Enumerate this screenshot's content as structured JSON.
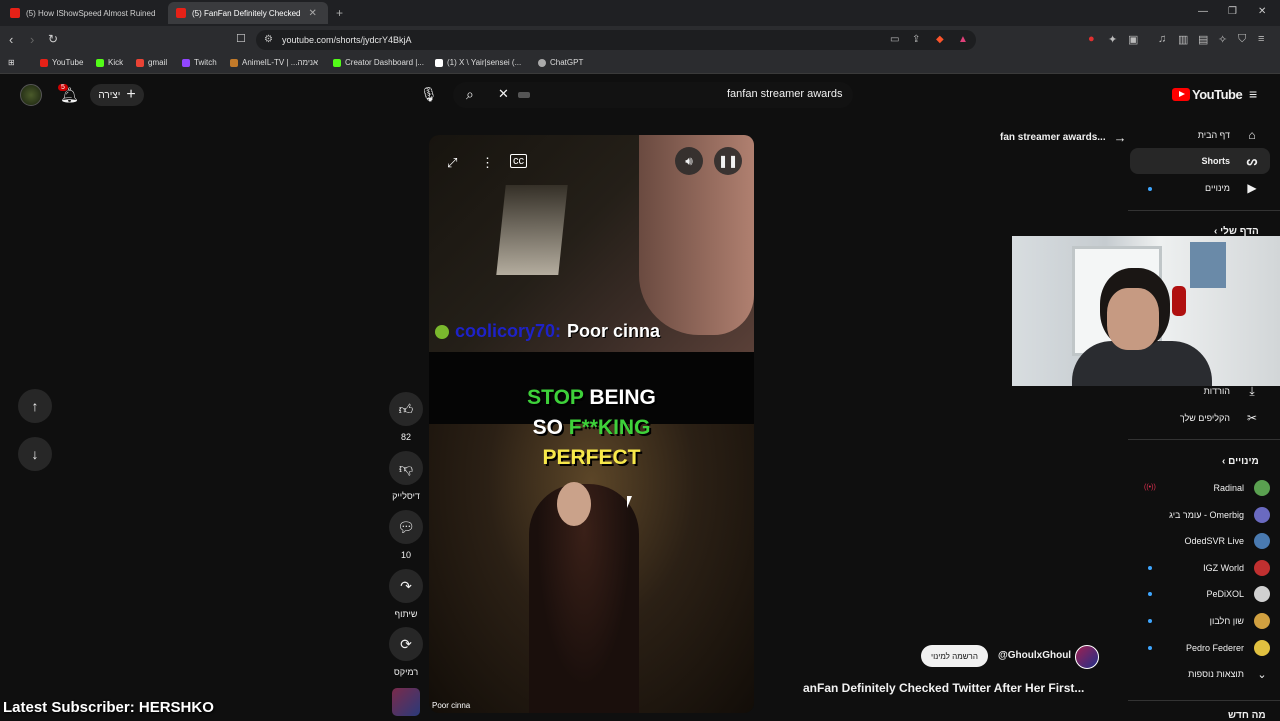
{
  "browser": {
    "tabs": [
      {
        "label": "(5) How IShowSpeed Almost Ruined"
      },
      {
        "label": "(5) FanFan Definitely Checked"
      }
    ],
    "url": "youtube.com/shorts/jydcrY4BkjA",
    "bookmarks": [
      {
        "label": "YouTube",
        "color": "#e62117"
      },
      {
        "label": "Kick",
        "color": "#53fc18"
      },
      {
        "label": "gmail",
        "color": "#ea4335"
      },
      {
        "label": "Twitch",
        "color": "#9146ff"
      },
      {
        "label": "AnimeIL-TV | ...אנימה",
        "color": "#c27a2a"
      },
      {
        "label": "Creator Dashboard |...",
        "color": "#53fc18"
      },
      {
        "label": "(1) X \\ Yair|sensei (...",
        "color": "#ffffff"
      },
      {
        "label": "ChatGPT",
        "color": "#aaaaaa"
      }
    ]
  },
  "header": {
    "notifications": "5",
    "create_label": "יצירה",
    "search_query": "fanfan streamer awards",
    "logo_text": "YouTube"
  },
  "video": {
    "chat_user": "coolicory70:",
    "chat_message": "Poor cinna",
    "caption_line1_a": "STOP",
    "caption_line1_b": "BEING",
    "caption_line2_a": "SO",
    "caption_line2_b": "F**KING",
    "caption_line3": "PERFECT",
    "bottom_label": "Poor cinna"
  },
  "actions": {
    "like_count": "82",
    "dislike_label": "דיסלייק",
    "comment_count": "10",
    "share_label": "שיתוף",
    "remix_label": "רמיקס"
  },
  "right": {
    "back_title": "fan streamer awards...",
    "subscribe_label": "הרשמה למינוי",
    "channel_handle": "@GhoulxGhoul",
    "video_title": "anFan Definitely Checked Twitter After Her First..."
  },
  "sidebar": {
    "items": [
      {
        "label": "דף הבית",
        "icon": "home-icon"
      },
      {
        "label": "Shorts",
        "icon": "shorts-icon"
      },
      {
        "label": "מינויים",
        "icon": "subscriptions-icon"
      }
    ],
    "you_section": "הדף שלי",
    "you_items": [
      {
        "label": "הורדות",
        "icon": "download-icon"
      },
      {
        "label": "הקליפים שלך",
        "icon": "scissors-icon"
      }
    ],
    "subs_heading": "מינויים",
    "subscriptions": [
      {
        "name": "Radinal",
        "color": "#5aa050"
      },
      {
        "name": "עומר ביג - Omerbig",
        "color": "#6a6ac0"
      },
      {
        "name": "OdedSVR Live",
        "color": "#4a7ab0"
      },
      {
        "name": "IGZ World",
        "color": "#c03030"
      },
      {
        "name": "PeDiXOL",
        "color": "#d0d0d0"
      },
      {
        "name": "שון חלבון",
        "color": "#d0a040"
      },
      {
        "name": "Pedro Federer",
        "color": "#e0c040"
      }
    ],
    "show_more": "תוצאות נוספות",
    "whats_new": "מה חדש"
  },
  "overlay": {
    "latest_subscriber": "Latest Subscriber: HERSHKO"
  }
}
